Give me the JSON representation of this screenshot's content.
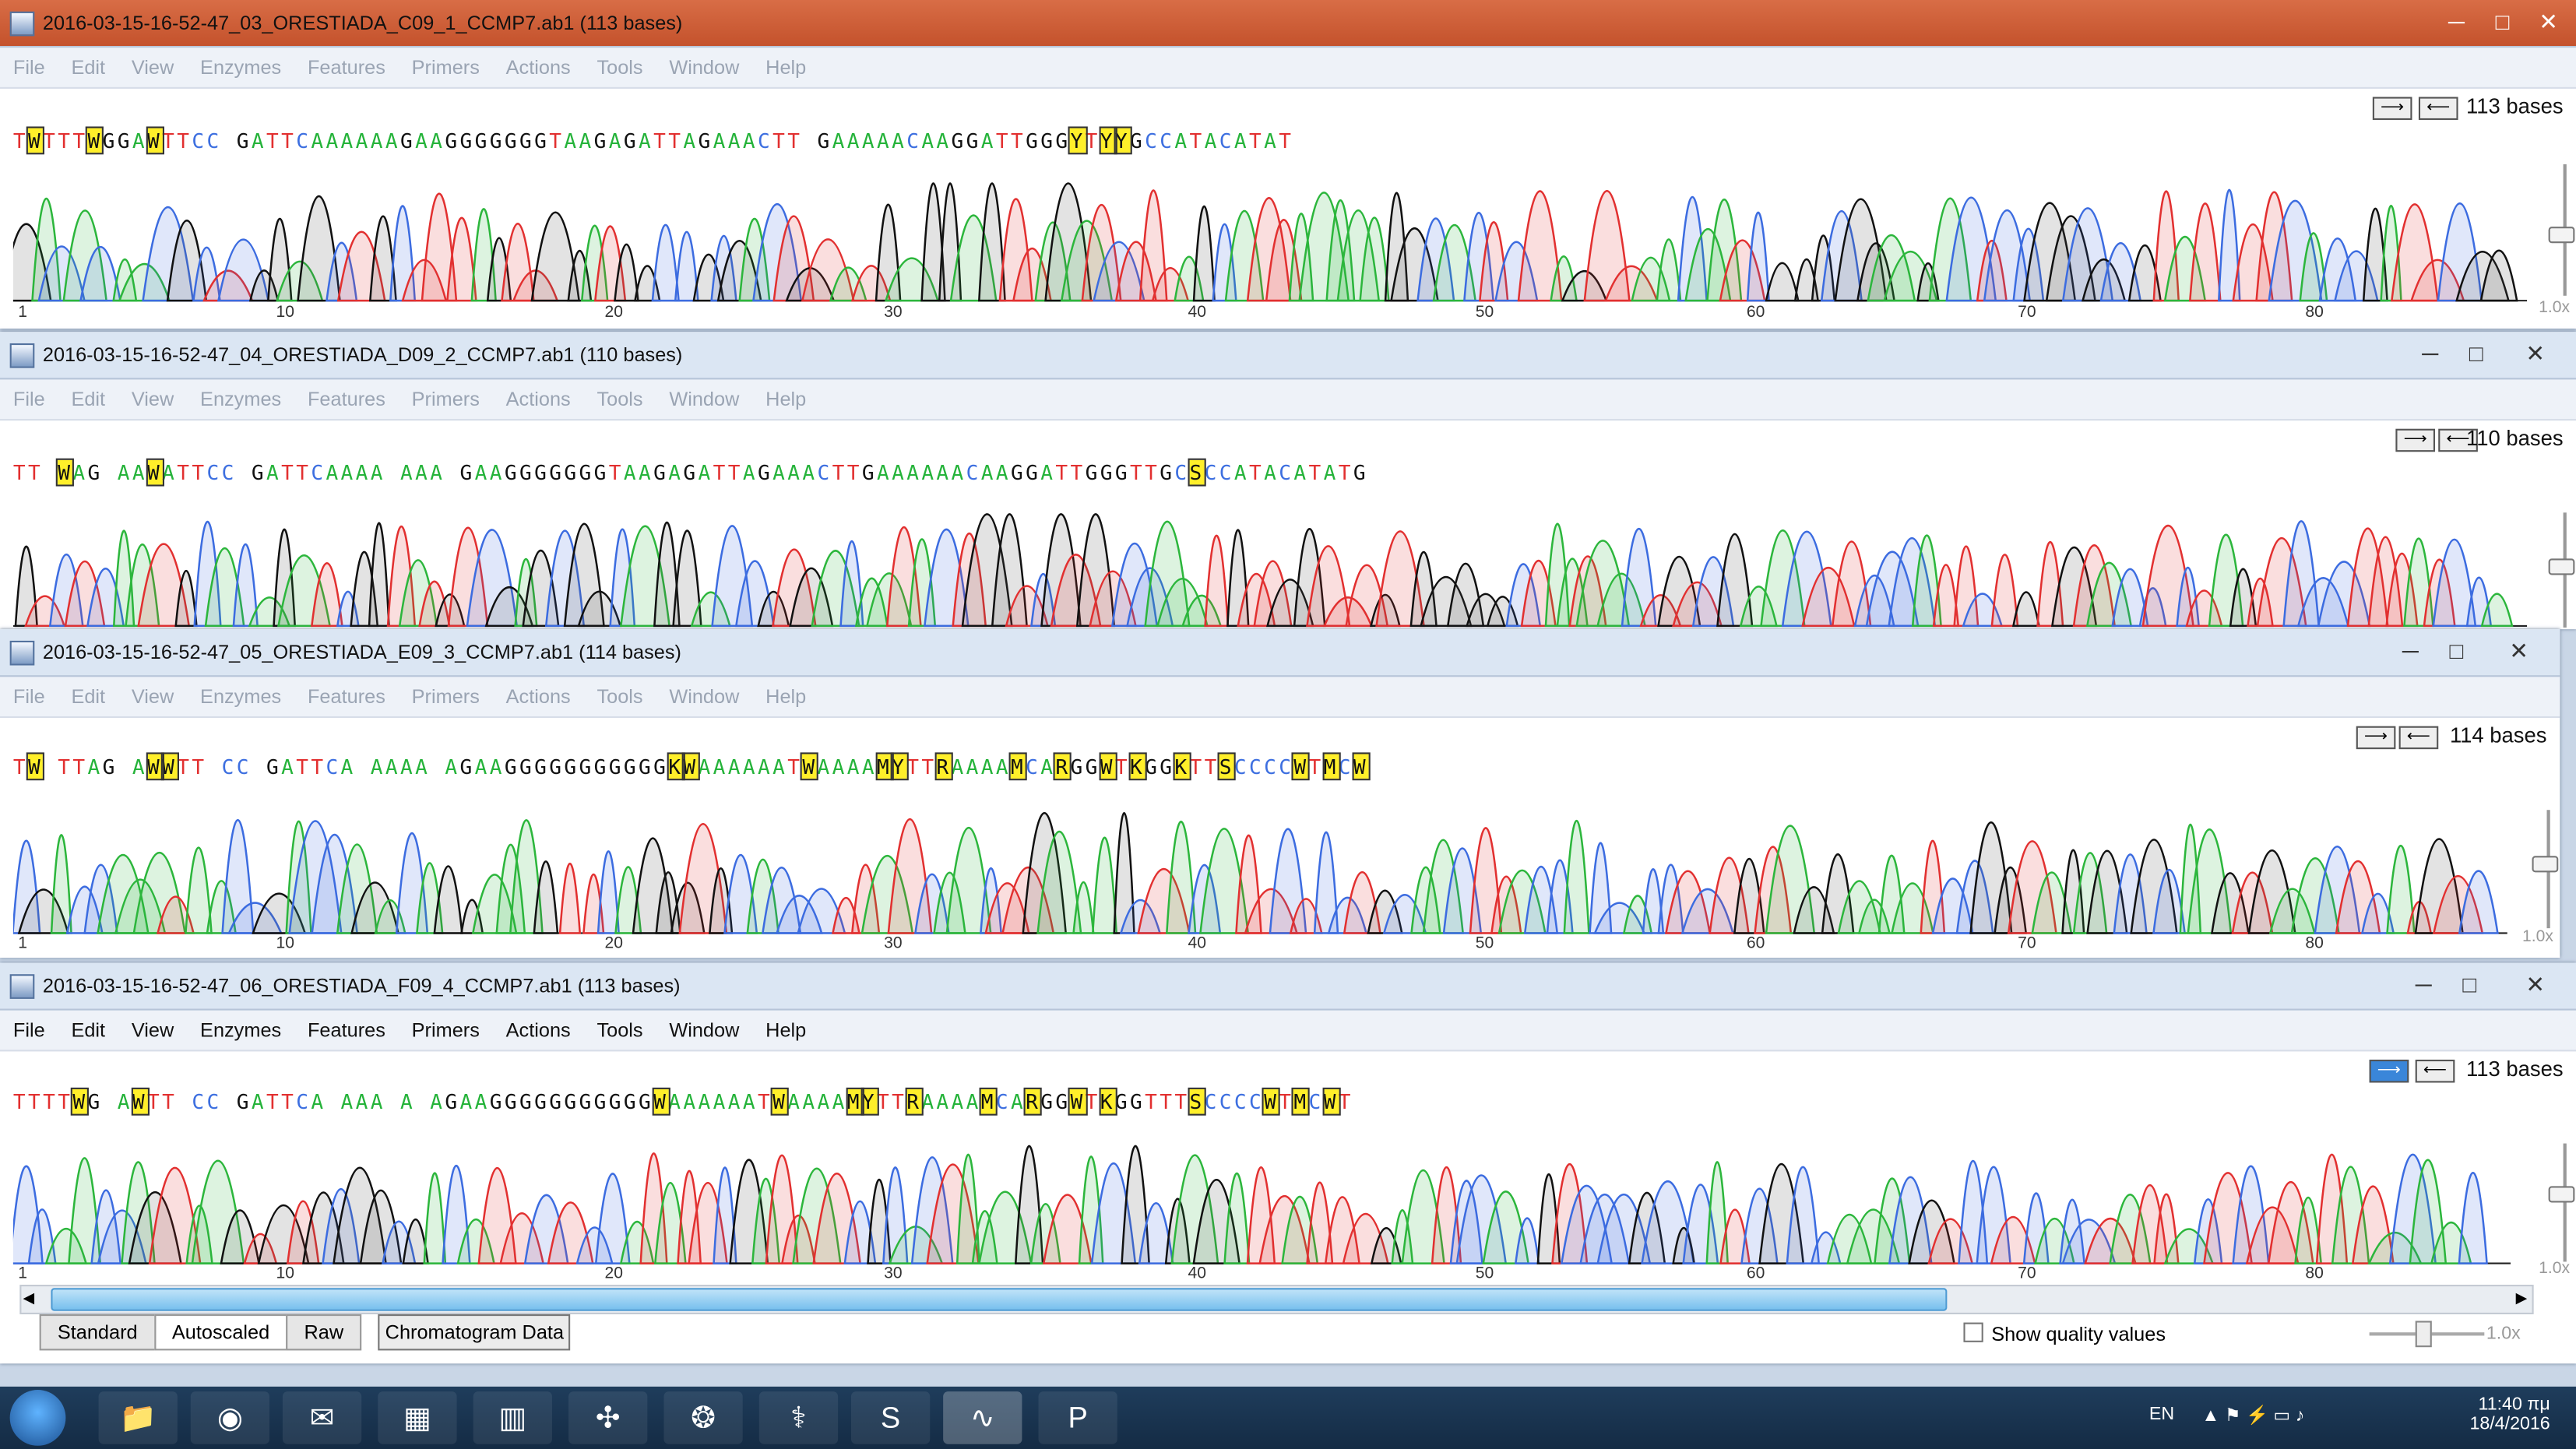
{
  "menu": [
    "File",
    "Edit",
    "View",
    "Enzymes",
    "Features",
    "Primers",
    "Actions",
    "Tools",
    "Window",
    "Help"
  ],
  "windows": [
    {
      "title": "2016-03-15-16-52-47_03_ORESTIADA_C09_1_CCMP7.ab1 (113 bases)",
      "bases": "113 bases",
      "seq": "TWTTTWGGAWTTCC GATTCAAAAAAGAAGGGGGGGTAAGAGATTAGAAACTT GAAAAACAAGGATTGGGYTYYGCCATACATAT",
      "ticks": [
        "1",
        "10",
        "20",
        "30",
        "40",
        "50",
        "60",
        "70",
        "80"
      ],
      "zoom": "1.0x"
    },
    {
      "title": "2016-03-15-16-52-47_04_ORESTIADA_D09_2_CCMP7.ab1 (110 bases)",
      "bases": "110 bases",
      "seq": "TT WAG AAWATTCC GATTCAAAA AAA GAAGGGGGGGTAAGAGATTAGAAACTTGAAAAAACAAGGATTGGGTTGCSCCATACATATG",
      "ticks": [],
      "zoom": ""
    },
    {
      "title": "2016-03-15-16-52-47_05_ORESTIADA_E09_3_CCMP7.ab1 (114 bases)",
      "bases": "114 bases",
      "seq": "TW TTAG AWWTT CC GATTCA AAAA AGAAGGGGGGGGGGGKWAAAAAATWAAAAMYTTRAAAAMCARGGWTKGGKTTSCCCCWTMCW",
      "ticks": [
        "1",
        "10",
        "20",
        "30",
        "40",
        "50",
        "60",
        "70",
        "80"
      ],
      "zoom": "1.0x"
    },
    {
      "title": "2016-03-15-16-52-47_06_ORESTIADA_F09_4_CCMP7.ab1 (113 bases)",
      "bases": "113 bases",
      "seq": "TTTTWG AWTT CC GATTCA AAA A AGAAGGGGGGGGGGGWAAAAAATWAAAAMYTTRAAAAMCARGGWTKGGTTTSCCCCWTMCWT",
      "ticks": [
        "1",
        "10",
        "20",
        "30",
        "40",
        "50",
        "60",
        "70",
        "80"
      ],
      "zoom": "1.0x"
    }
  ],
  "bottom": {
    "tabs": [
      "Standard",
      "Autoscaled",
      "Raw"
    ],
    "button": "Chromatogram Data",
    "show_quality": "Show quality values",
    "zoom": "1.0x"
  },
  "tray": {
    "lang": "EN",
    "time": "11:40 πμ",
    "date": "18/4/2016"
  }
}
